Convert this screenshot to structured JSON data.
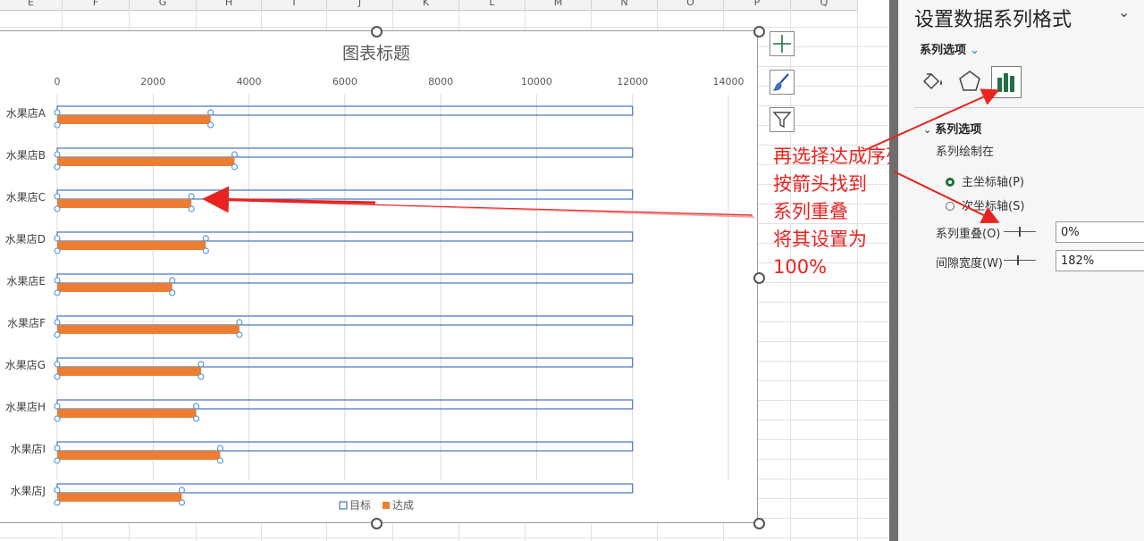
{
  "sheet": {
    "columns": [
      "E",
      "F",
      "G",
      "H",
      "I",
      "J",
      "K",
      "L",
      "M",
      "N",
      "O",
      "P",
      "Q"
    ]
  },
  "colors": {
    "target_border": "#4472c4",
    "achieved_fill": "#ed7d31",
    "annotation": "#e8231f",
    "accent_green": "#217346"
  },
  "chart_data": {
    "type": "bar",
    "title": "图表标题",
    "categories": [
      "水果店A",
      "水果店B",
      "水果店C",
      "水果店D",
      "水果店E",
      "水果店F",
      "水果店G",
      "水果店H",
      "水果店I",
      "水果店J"
    ],
    "series": [
      {
        "name": "目标",
        "values": [
          12000,
          12000,
          12000,
          12000,
          12000,
          12000,
          12000,
          12000,
          12000,
          12000
        ]
      },
      {
        "name": "达成",
        "values": [
          3200,
          3700,
          2800,
          3100,
          2400,
          3800,
          3000,
          2900,
          3400,
          2600
        ]
      }
    ],
    "xlim": [
      0,
      14000
    ],
    "xticks": [
      "0",
      "2000",
      "4000",
      "6000",
      "8000",
      "10000",
      "12000",
      "14000"
    ],
    "axis_position": "top",
    "grid": true,
    "legend_position": "bottom"
  },
  "annotation": {
    "lines": [
      "再选择达成序列",
      "按箭头找到",
      "系列重叠",
      "将其设置为",
      "100%"
    ]
  },
  "chart_tools": {
    "elements_icon": "plus-icon",
    "styles_icon": "brush-icon",
    "filter_icon": "funnel-icon"
  },
  "pane": {
    "title": "设置数据系列格式",
    "options_tab": "系列选项",
    "icons": [
      "paint-bucket-icon",
      "pentagon-icon",
      "bar-chart-icon"
    ],
    "section_title": "系列选项",
    "plot_on_label": "系列绘制在",
    "primary_axis": "主坐标轴(P)",
    "secondary_axis": "次坐标轴(S)",
    "overlap_label": "系列重叠(O)",
    "overlap_value": "0%",
    "gap_label": "间隙宽度(W)",
    "gap_value": "182%"
  }
}
